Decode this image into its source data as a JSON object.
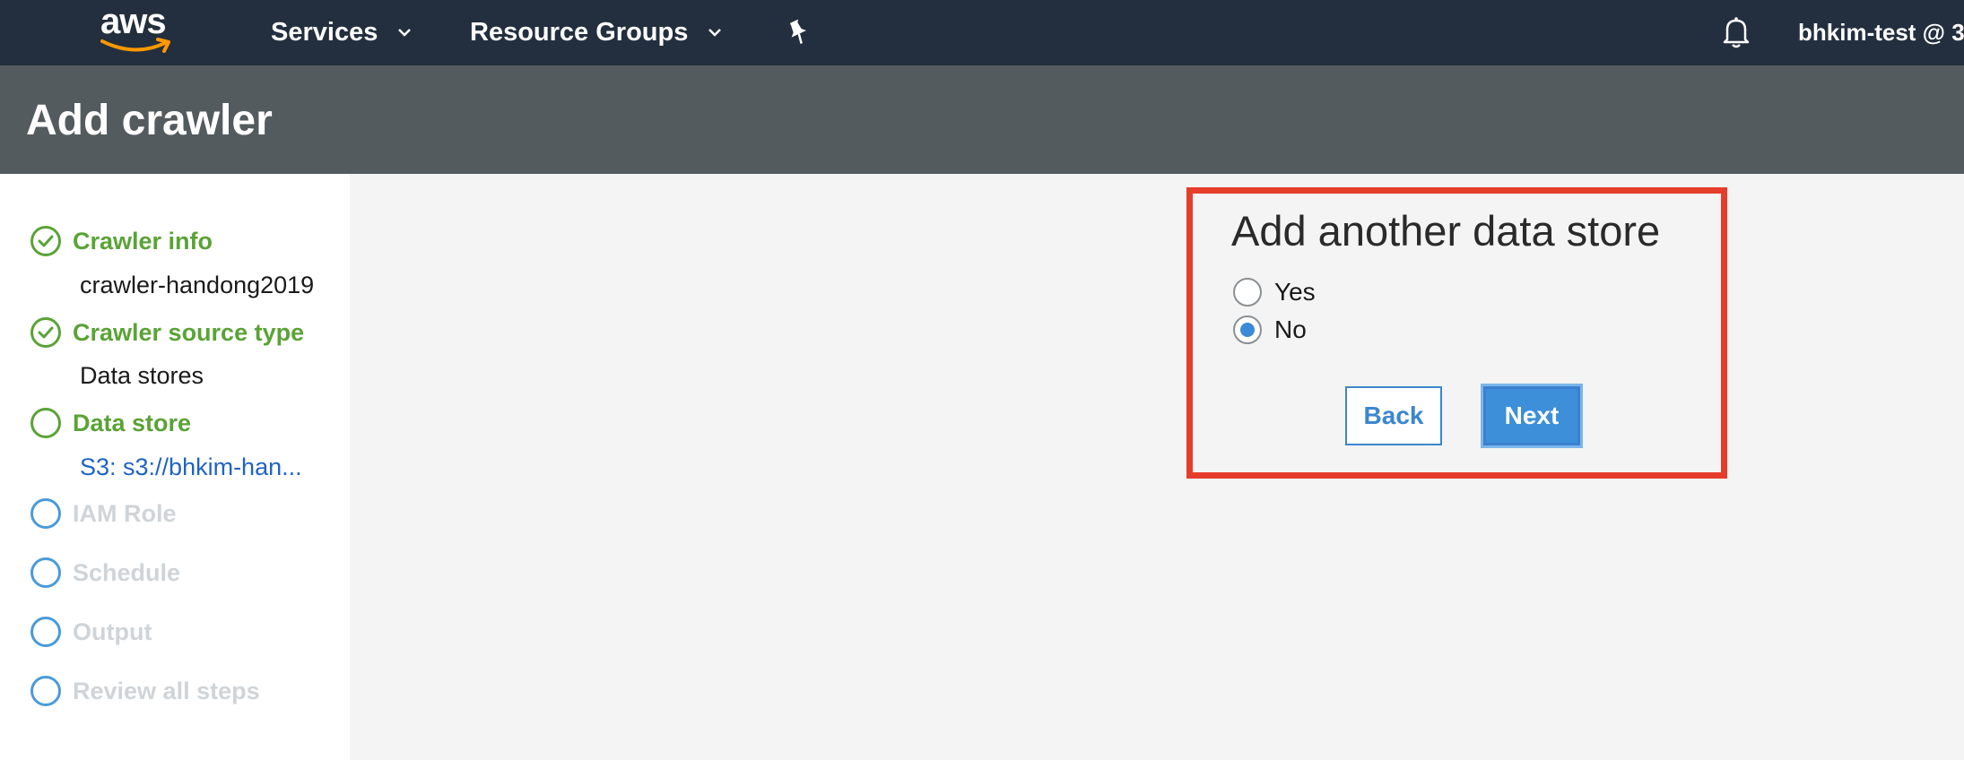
{
  "topnav": {
    "logo_text": "aws",
    "services_label": "Services",
    "resource_groups_label": "Resource Groups",
    "account_label": "bhkim-test @ 3"
  },
  "header": {
    "title": "Add crawler"
  },
  "sidebar": {
    "steps": [
      {
        "label": "Crawler info",
        "state": "done",
        "detail": "crawler-handong2019"
      },
      {
        "label": "Crawler source type",
        "state": "done",
        "detail": "Data stores"
      },
      {
        "label": "Data store",
        "state": "current",
        "detail": "S3: s3://bhkim-han..."
      },
      {
        "label": "IAM Role",
        "state": "future"
      },
      {
        "label": "Schedule",
        "state": "future"
      },
      {
        "label": "Output",
        "state": "future"
      },
      {
        "label": "Review all steps",
        "state": "future"
      }
    ]
  },
  "panel": {
    "title": "Add another data store",
    "options": [
      {
        "label": "Yes",
        "checked": false
      },
      {
        "label": "No",
        "checked": true
      }
    ],
    "back_label": "Back",
    "next_label": "Next"
  },
  "colors": {
    "nav_bg": "#232f3e",
    "title_bg": "#545b5f",
    "step_done": "#5aa336",
    "step_future": "#cfd4d8",
    "highlight_border": "#e63d2b",
    "primary_button": "#3c8fd8"
  }
}
